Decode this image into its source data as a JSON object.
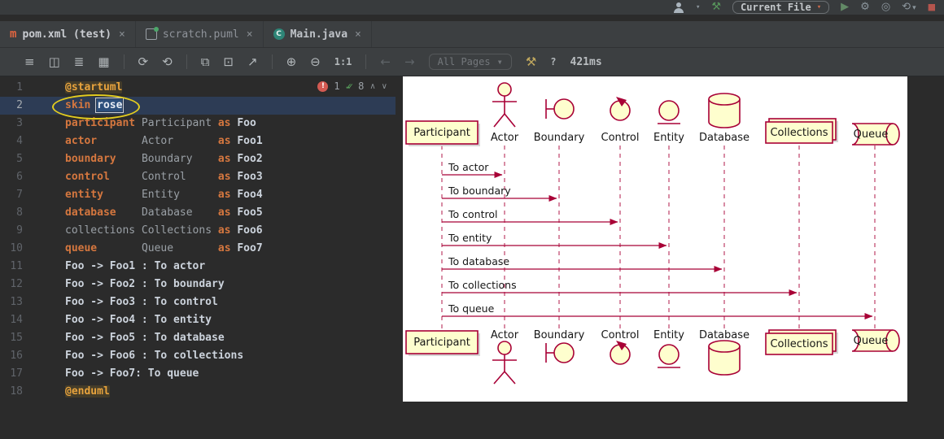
{
  "top_bar": {
    "current_file_label": "Current File"
  },
  "icons": {
    "dropdown": "▾",
    "build": "⚒",
    "run": "▶",
    "settings": "⚙",
    "coverage": "◎",
    "history": "⟲",
    "stop": "■",
    "view_list": "≡",
    "view_split": "◫",
    "view_list2": "≣",
    "view_image": "▦",
    "refresh": "⟳",
    "reload_all": "⟲",
    "copy": "⧉",
    "save": "⊡",
    "export": "↗",
    "zoom_in": "⊕",
    "zoom_out": "⊖",
    "zoom_reset": "1:1",
    "back": "←",
    "forward": "→",
    "wrench": "⚒",
    "help": "?",
    "close": "×",
    "up": "∧",
    "down": "∨",
    "error": "!"
  },
  "tabs": [
    {
      "label": "pom.xml (test)",
      "icon_letter": "m"
    },
    {
      "label": "scratch.puml"
    },
    {
      "label": "Main.java",
      "icon_letter": "C"
    }
  ],
  "toolbar": {
    "pages": "All Pages",
    "timing": "421ms"
  },
  "inspections": {
    "errors": "1",
    "passed": "8",
    "checks": "✓✓"
  },
  "editor": {
    "lines": [
      {
        "n": 1,
        "tokens": [
          [
            "d",
            "@startuml"
          ]
        ]
      },
      {
        "n": 2,
        "current": true,
        "tokens": [
          [
            "k",
            "skin"
          ],
          [
            "t",
            " "
          ],
          [
            "sel",
            "rose"
          ]
        ]
      },
      {
        "n": 3,
        "tokens": [
          [
            "k",
            "participant"
          ],
          [
            "t",
            " "
          ],
          [
            "i",
            "Participant"
          ],
          [
            "t",
            " "
          ],
          [
            "a",
            "as"
          ],
          [
            "t",
            " "
          ],
          [
            "n",
            "Foo"
          ]
        ]
      },
      {
        "n": 4,
        "tokens": [
          [
            "k",
            "actor"
          ],
          [
            "t",
            "       "
          ],
          [
            "i",
            "Actor"
          ],
          [
            "t",
            "       "
          ],
          [
            "a",
            "as"
          ],
          [
            "t",
            " "
          ],
          [
            "n",
            "Foo1"
          ]
        ]
      },
      {
        "n": 5,
        "tokens": [
          [
            "k",
            "boundary"
          ],
          [
            "t",
            "    "
          ],
          [
            "i",
            "Boundary"
          ],
          [
            "t",
            "    "
          ],
          [
            "a",
            "as"
          ],
          [
            "t",
            " "
          ],
          [
            "n",
            "Foo2"
          ]
        ]
      },
      {
        "n": 6,
        "tokens": [
          [
            "k",
            "control"
          ],
          [
            "t",
            "     "
          ],
          [
            "i",
            "Control"
          ],
          [
            "t",
            "     "
          ],
          [
            "a",
            "as"
          ],
          [
            "t",
            " "
          ],
          [
            "n",
            "Foo3"
          ]
        ]
      },
      {
        "n": 7,
        "tokens": [
          [
            "k",
            "entity"
          ],
          [
            "t",
            "      "
          ],
          [
            "i",
            "Entity"
          ],
          [
            "t",
            "      "
          ],
          [
            "a",
            "as"
          ],
          [
            "t",
            " "
          ],
          [
            "n",
            "Foo4"
          ]
        ]
      },
      {
        "n": 8,
        "tokens": [
          [
            "k",
            "database"
          ],
          [
            "t",
            "    "
          ],
          [
            "i",
            "Database"
          ],
          [
            "t",
            "    "
          ],
          [
            "a",
            "as"
          ],
          [
            "t",
            " "
          ],
          [
            "n",
            "Foo5"
          ]
        ]
      },
      {
        "n": 9,
        "tokens": [
          [
            "i",
            "collections"
          ],
          [
            "t",
            " "
          ],
          [
            "i",
            "Collections"
          ],
          [
            "t",
            " "
          ],
          [
            "a",
            "as"
          ],
          [
            "t",
            " "
          ],
          [
            "n",
            "Foo6"
          ]
        ]
      },
      {
        "n": 10,
        "tokens": [
          [
            "k",
            "queue"
          ],
          [
            "t",
            "       "
          ],
          [
            "i",
            "Queue"
          ],
          [
            "t",
            "       "
          ],
          [
            "a",
            "as"
          ],
          [
            "t",
            " "
          ],
          [
            "n",
            "Foo7"
          ]
        ]
      },
      {
        "n": 11,
        "tokens": [
          [
            "n",
            "Foo -> Foo1 : To actor"
          ]
        ]
      },
      {
        "n": 12,
        "tokens": [
          [
            "n",
            "Foo -> Foo2 : To boundary"
          ]
        ]
      },
      {
        "n": 13,
        "tokens": [
          [
            "n",
            "Foo -> Foo3 : To control"
          ]
        ]
      },
      {
        "n": 14,
        "tokens": [
          [
            "n",
            "Foo -> Foo4 : To entity"
          ]
        ]
      },
      {
        "n": 15,
        "tokens": [
          [
            "n",
            "Foo -> Foo5 : To database"
          ]
        ]
      },
      {
        "n": 16,
        "tokens": [
          [
            "n",
            "Foo -> Foo6 : To collections"
          ]
        ]
      },
      {
        "n": 17,
        "tokens": [
          [
            "n",
            "Foo -> Foo7: To queue"
          ]
        ]
      },
      {
        "n": 18,
        "tokens": [
          [
            "d",
            "@enduml"
          ]
        ]
      }
    ]
  },
  "diagram": {
    "skin": "rose",
    "colors": {
      "border": "#A80036",
      "fill": "#FEFECE",
      "background": "#FFFFFF"
    },
    "participants": [
      {
        "name": "Participant",
        "kind": "participant",
        "alias": "Foo"
      },
      {
        "name": "Actor",
        "kind": "actor",
        "alias": "Foo1"
      },
      {
        "name": "Boundary",
        "kind": "boundary",
        "alias": "Foo2"
      },
      {
        "name": "Control",
        "kind": "control",
        "alias": "Foo3"
      },
      {
        "name": "Entity",
        "kind": "entity",
        "alias": "Foo4"
      },
      {
        "name": "Database",
        "kind": "database",
        "alias": "Foo5"
      },
      {
        "name": "Collections",
        "kind": "collections",
        "alias": "Foo6"
      },
      {
        "name": "Queue",
        "kind": "queue",
        "alias": "Foo7"
      }
    ],
    "messages": [
      {
        "from": "Foo",
        "to": "Foo1",
        "label": "To actor"
      },
      {
        "from": "Foo",
        "to": "Foo2",
        "label": "To boundary"
      },
      {
        "from": "Foo",
        "to": "Foo3",
        "label": "To control"
      },
      {
        "from": "Foo",
        "to": "Foo4",
        "label": "To entity"
      },
      {
        "from": "Foo",
        "to": "Foo5",
        "label": "To database"
      },
      {
        "from": "Foo",
        "to": "Foo6",
        "label": "To collections"
      },
      {
        "from": "Foo",
        "to": "Foo7",
        "label": "To queue"
      }
    ]
  }
}
